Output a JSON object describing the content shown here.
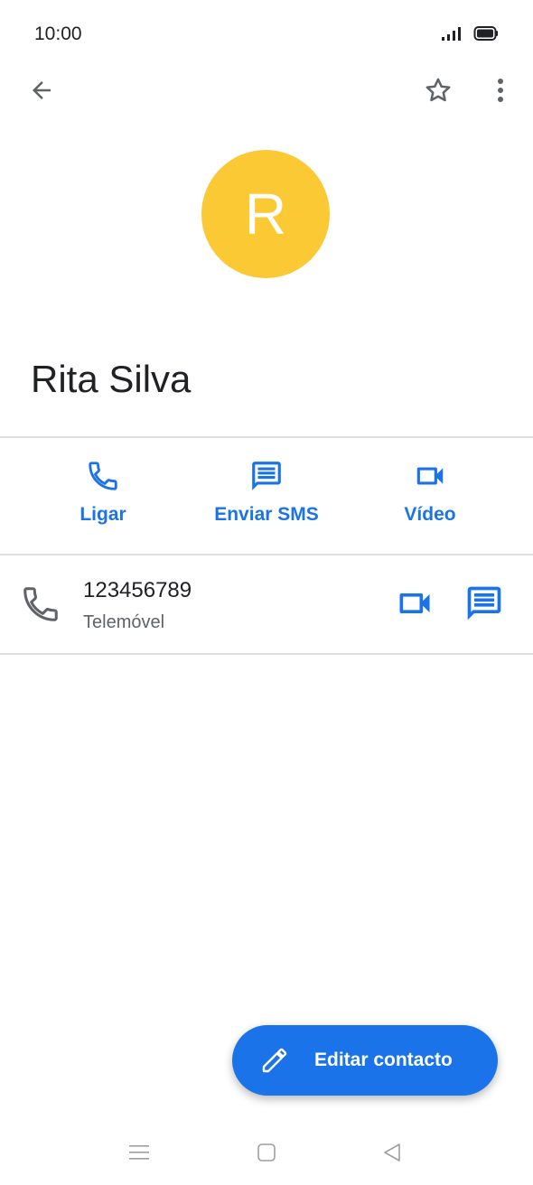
{
  "status_bar": {
    "time": "10:00",
    "icons": [
      "signal-icon",
      "battery-icon"
    ]
  },
  "app_bar": {
    "icons": [
      "back-arrow-icon",
      "star-outline-icon",
      "more-vert-icon"
    ]
  },
  "contact": {
    "initial": "R",
    "avatar_color": "#fbc934",
    "name": "Rita Silva"
  },
  "quick_actions": [
    {
      "label": "Ligar",
      "icon": "phone-icon"
    },
    {
      "label": "Enviar SMS",
      "icon": "message-icon"
    },
    {
      "label": "Vídeo",
      "icon": "videocam-icon"
    }
  ],
  "phone_entry": {
    "number": "123456789",
    "type": "Telemóvel",
    "icons": [
      "phone-icon",
      "videocam-icon",
      "message-icon"
    ]
  },
  "fab": {
    "label": "Editar contacto",
    "icon": "edit-pencil-icon"
  },
  "nav_bar": {
    "icons": [
      "menu-icon",
      "home-square-icon",
      "back-triangle-icon"
    ]
  },
  "colors": {
    "accent": "#1a73e8",
    "text": "#202124",
    "secondary_text": "#5f6368",
    "divider": "#e0e0e0"
  }
}
